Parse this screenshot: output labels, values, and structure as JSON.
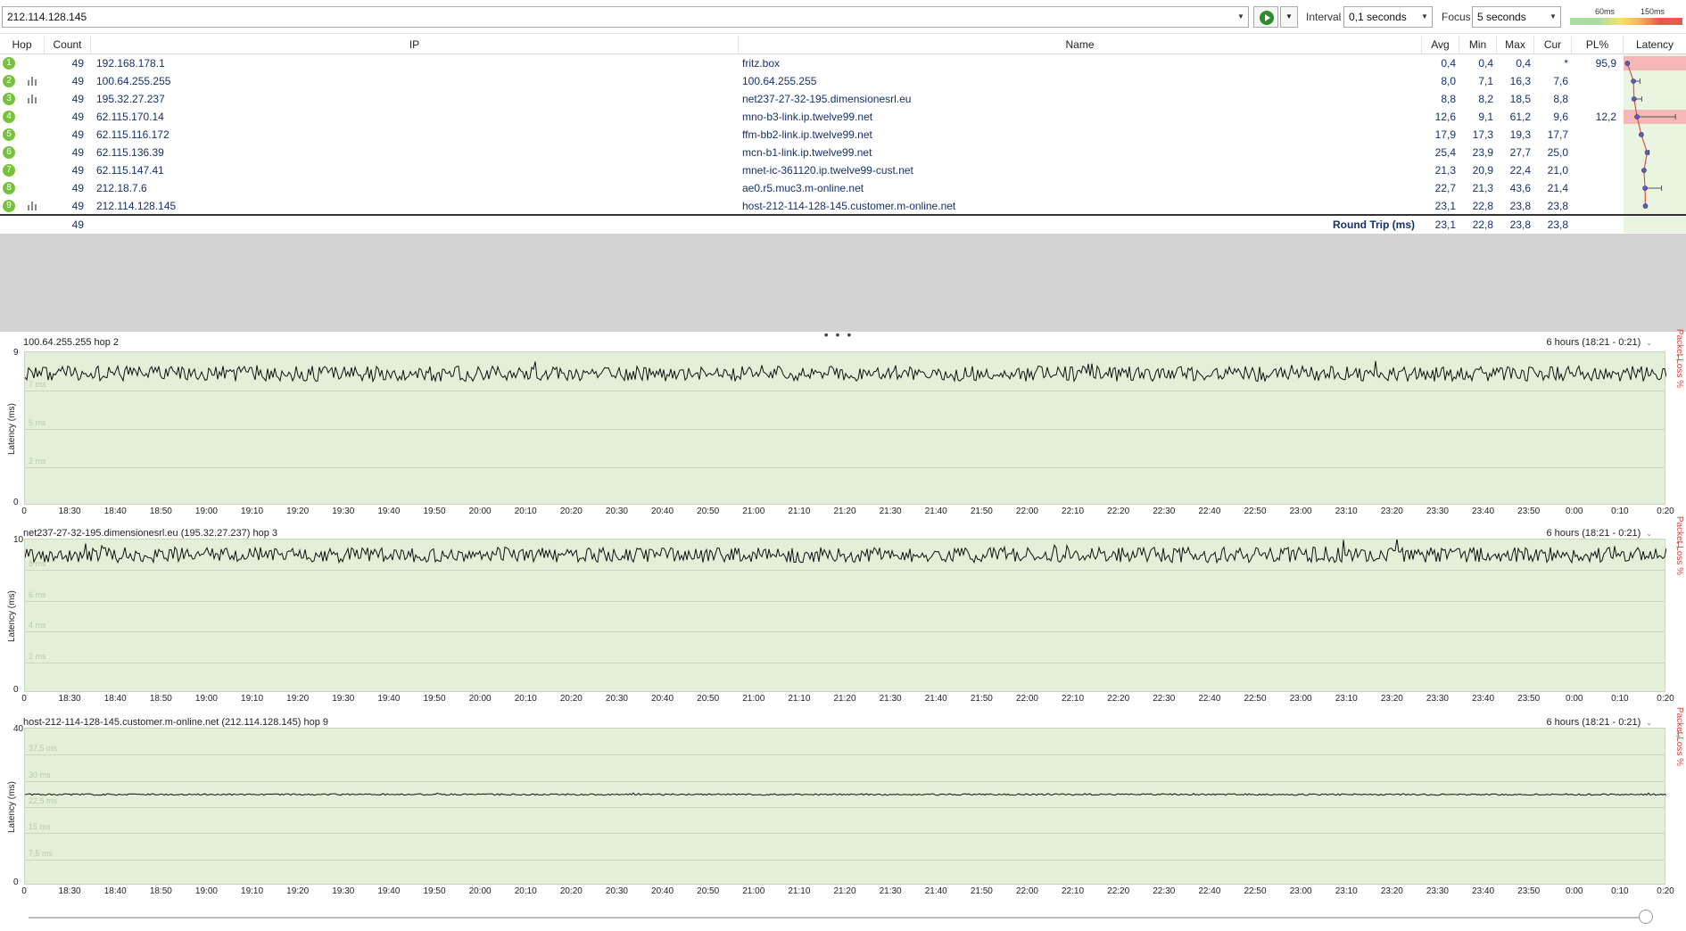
{
  "toolbar": {
    "target": "212.114.128.145",
    "interval_label": "Interval",
    "interval_value": "0,1 seconds",
    "focus_label": "Focus",
    "focus_value": "5 seconds",
    "legend_low": "60ms",
    "legend_high": "150ms"
  },
  "table": {
    "headers": {
      "hop": "Hop",
      "count": "Count",
      "ip": "IP",
      "name": "Name",
      "avg": "Avg",
      "min": "Min",
      "max": "Max",
      "cur": "Cur",
      "pl": "PL%",
      "latency": "Latency"
    },
    "rows": [
      {
        "hop": "1",
        "count": "49",
        "ip": "192.168.178.1",
        "name": "fritz.box",
        "avg": "0,4",
        "min": "0,4",
        "max": "0,4",
        "cur": "*",
        "pl": "95,9",
        "has_graph": false
      },
      {
        "hop": "2",
        "count": "49",
        "ip": "100.64.255.255",
        "name": "100.64.255.255",
        "avg": "8,0",
        "min": "7,1",
        "max": "16,3",
        "cur": "7,6",
        "pl": "",
        "has_graph": true
      },
      {
        "hop": "3",
        "count": "49",
        "ip": "195.32.27.237",
        "name": "net237-27-32-195.dimensionesrl.eu",
        "avg": "8,8",
        "min": "8,2",
        "max": "18,5",
        "cur": "8,8",
        "pl": "",
        "has_graph": true
      },
      {
        "hop": "4",
        "count": "49",
        "ip": "62.115.170.14",
        "name": "mno-b3-link.ip.twelve99.net",
        "avg": "12,6",
        "min": "9,1",
        "max": "61,2",
        "cur": "9,6",
        "pl": "12,2",
        "has_graph": false
      },
      {
        "hop": "5",
        "count": "49",
        "ip": "62.115.116.172",
        "name": "ffm-bb2-link.ip.twelve99.net",
        "avg": "17,9",
        "min": "17,3",
        "max": "19,3",
        "cur": "17,7",
        "pl": "",
        "has_graph": false
      },
      {
        "hop": "6",
        "count": "49",
        "ip": "62.115.136.39",
        "name": "mcn-b1-link.ip.twelve99.net",
        "avg": "25,4",
        "min": "23,9",
        "max": "27,7",
        "cur": "25,0",
        "pl": "",
        "has_graph": false
      },
      {
        "hop": "7",
        "count": "49",
        "ip": "62.115.147.41",
        "name": "mnet-ic-361120.ip.twelve99-cust.net",
        "avg": "21,3",
        "min": "20,9",
        "max": "22,4",
        "cur": "21,0",
        "pl": "",
        "has_graph": false
      },
      {
        "hop": "8",
        "count": "49",
        "ip": "212.18.7.6",
        "name": "ae0.r5.muc3.m-online.net",
        "avg": "22,7",
        "min": "21,3",
        "max": "43,6",
        "cur": "21,4",
        "pl": "",
        "has_graph": false
      },
      {
        "hop": "9",
        "count": "49",
        "ip": "212.114.128.145",
        "name": "host-212-114-128-145.customer.m-online.net",
        "avg": "23,1",
        "min": "22,8",
        "max": "23,8",
        "cur": "23,8",
        "pl": "",
        "has_graph": true
      }
    ],
    "roundtrip": {
      "count": "49",
      "label": "Round Trip (ms)",
      "avg": "23,1",
      "min": "22,8",
      "max": "23,8",
      "cur": "23,8"
    },
    "colors": {
      "pl_bad": "#f5b7b7",
      "lat_bg": "#e9f5e1",
      "trace": "#e05050",
      "hop_dot": "#77c13c"
    }
  },
  "time_ticks": [
    "0",
    "18:30",
    "18:40",
    "18:50",
    "19:00",
    "19:10",
    "19:20",
    "19:30",
    "19:40",
    "19:50",
    "20:00",
    "20:10",
    "20:20",
    "20:30",
    "20:40",
    "20:50",
    "21:00",
    "21:10",
    "21:20",
    "21:30",
    "21:40",
    "21:50",
    "22:00",
    "22:10",
    "22:20",
    "22:30",
    "22:40",
    "22:50",
    "23:00",
    "23:10",
    "23:20",
    "23:30",
    "23:40",
    "23:50",
    "0:00",
    "0:10",
    "0:20"
  ],
  "graphs": [
    {
      "title": "100.64.255.255 hop 2",
      "range": "6 hours (18:21 - 0:21)",
      "ymax": "9",
      "ymin": "0",
      "ylabel": "Latency (ms)",
      "plabel": "Packet Loss %",
      "ptop": "1",
      "ghost": [
        "7 ms",
        "5 ms",
        "2 ms"
      ],
      "level": 0.86,
      "noise": 0.05
    },
    {
      "title": "net237-27-32-195.dimensionesrl.eu (195.32.27.237) hop 3",
      "range": "6 hours (18:21 - 0:21)",
      "ymax": "10",
      "ymin": "0",
      "ylabel": "Latency (ms)",
      "plabel": "Packet Loss %",
      "ptop": "1",
      "ghost": [
        "8 ms",
        "6 ms",
        "4 ms",
        "2 ms"
      ],
      "level": 0.9,
      "noise": 0.05
    },
    {
      "title": "host-212-114-128-145.customer.m-online.net (212.114.128.145) hop 9",
      "range": "6 hours (18:21 - 0:21)",
      "ymax": "40",
      "ymin": "0",
      "ylabel": "Latency (ms)",
      "plabel": "Packet Loss %",
      "ptop": "1",
      "ghost": [
        "37,5 ms",
        "30 ms",
        "22,5 ms",
        "15 ms",
        "7,5 ms"
      ],
      "level": 0.58,
      "noise": 0.005
    }
  ]
}
